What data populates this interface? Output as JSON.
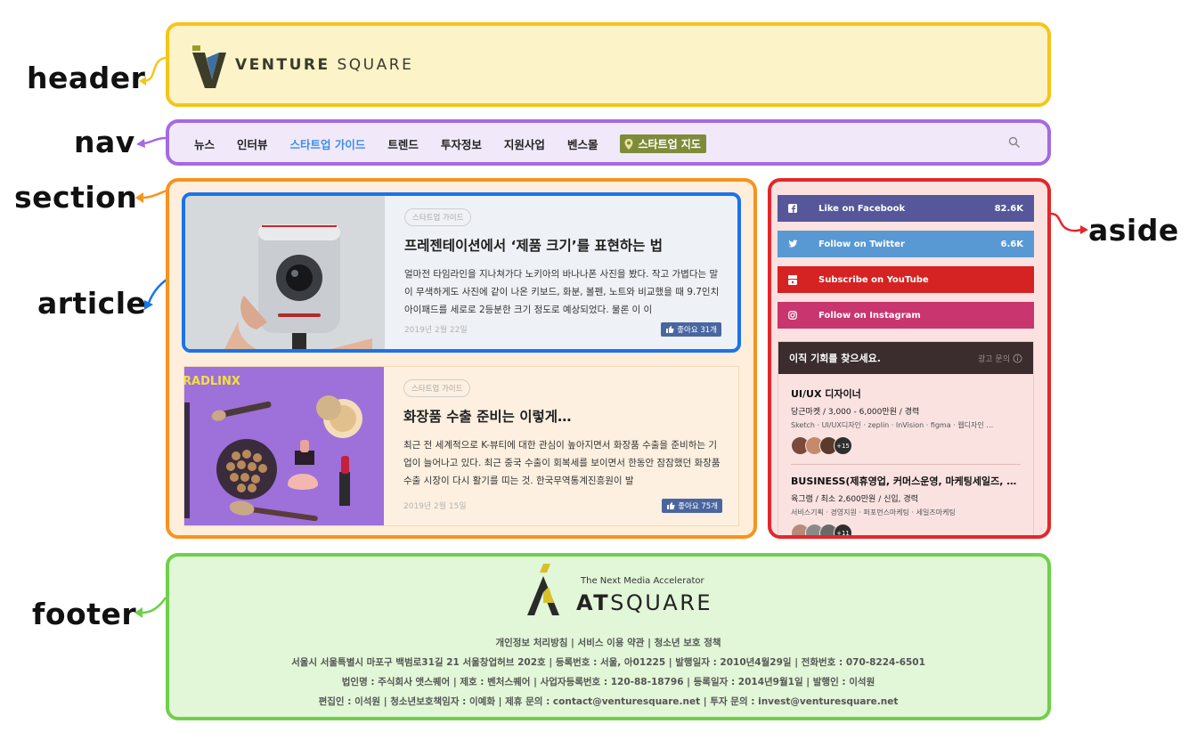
{
  "labels": {
    "header": "header",
    "nav": "nav",
    "section": "section",
    "article": "article",
    "aside": "aside",
    "footer": "footer"
  },
  "colors": {
    "header": "#f5c518",
    "nav": "#a46ae2",
    "section": "#f7931e",
    "article": "#1b74e8",
    "aside": "#e3272b",
    "footer": "#6fd04a"
  },
  "header": {
    "logo_bold": "VENTURE",
    "logo_light": " SQUARE",
    "logo_icon": "venture-square-logo"
  },
  "nav": {
    "items": [
      "뉴스",
      "인터뷰",
      "스타트업 가이드",
      "트렌드",
      "투자정보",
      "지원사업",
      "벤스몰"
    ],
    "active_index": 2,
    "map_label": "스타트업 지도",
    "map_icon": "map-pin-icon",
    "search_icon": "search-icon"
  },
  "articles": [
    {
      "tag": "스타트업 가이드",
      "title": "프레젠테이션에서 ‘제품 크기’를 표현하는 법",
      "excerpt": "얼마전 타임라인을 지나쳐가다 노키아의 바나나폰 사진을 봤다. 작고 가볍다는 말이 무색하게도 사진에 같이 나온 키보드, 화분, 볼펜, 노트와 비교했을 때 9.7인치 아이패드를 세로로 2등분한 크기 정도로 예상되었다. 물론 이 이",
      "date": "2019년 2월 22일",
      "likes": "좋아요 31개"
    },
    {
      "tag": "스타트업 가이드",
      "title": "화장품 수출 준비는 이렇게…",
      "excerpt": "최근 전 세계적으로 K-뷰티에 대한 관심이 높아지면서 화장품 수출을 준비하는 기업이 늘어나고 있다. 최근 중국 수출이 회복세를 보이면서 한동안 잠잠했던 화장품 수출 시장이 다시 활기를 띠는 것. 한국무역통계진흥원이 발",
      "date": "2019년 2월 15일",
      "likes": "좋아요 75개",
      "thumb_brand": "RADLINX"
    }
  ],
  "aside": {
    "social": [
      {
        "label": "Like on Facebook",
        "count": "82.6K",
        "color": "#55579a",
        "icon": "facebook-icon"
      },
      {
        "label": "Follow on Twitter",
        "count": "6.6K",
        "color": "#5899d4",
        "icon": "twitter-icon"
      },
      {
        "label": "Subscribe on YouTube",
        "count": "",
        "color": "#d42322",
        "icon": "youtube-icon"
      },
      {
        "label": "Follow on Instagram",
        "count": "",
        "color": "#c8356f",
        "icon": "instagram-icon"
      }
    ],
    "jobs_header": "이직 기회를 찾으세요.",
    "jobs_ad": "광고 문의",
    "jobs": [
      {
        "title": "UI/UX 디자이너",
        "company": "당근마켓 / 3,000 - 6,000만원 / 경력",
        "tags": "Sketch · UI/UX디자인 · zeplin · InVision · figma · 웹디자인 …",
        "more": "+15"
      },
      {
        "title": "BUSINESS(제휴영업, 커머스운영, 마케팅세일즈, …",
        "company": "육그램 / 최소 2,600만원 / 신입, 경력",
        "tags": "서비스기획 · 경영지원 · 퍼포먼스마케팅 · 세일즈마케팅",
        "more": "+11"
      }
    ]
  },
  "footer": {
    "tagline": "The Next Media Accelerator",
    "brand_bold": "AT",
    "brand_light": "SQUARE",
    "lines": [
      "개인정보 처리방침 | 서비스 이용 약관 | 청소년 보호 정책",
      "서울시 서울특별시 마포구 백범로31길 21 서울창업허브 202호 | 등록번호 : 서울, 아01225 | 발행일자 : 2010년4월29일 | 전화번호 : 070-8224-6501",
      "법인명 : 주식회사 앳스퀘어 | 제호 : 벤처스퀘어 | 사업자등록번호 : 120-88-18796 | 등록일자 : 2014년9월1일 | 발행인 : 이석원",
      "편집인 : 이석원 | 청소년보호책임자 : 이예화 | 제휴 문의 : contact@venturesquare.net | 투자 문의 : invest@venturesquare.net"
    ]
  }
}
